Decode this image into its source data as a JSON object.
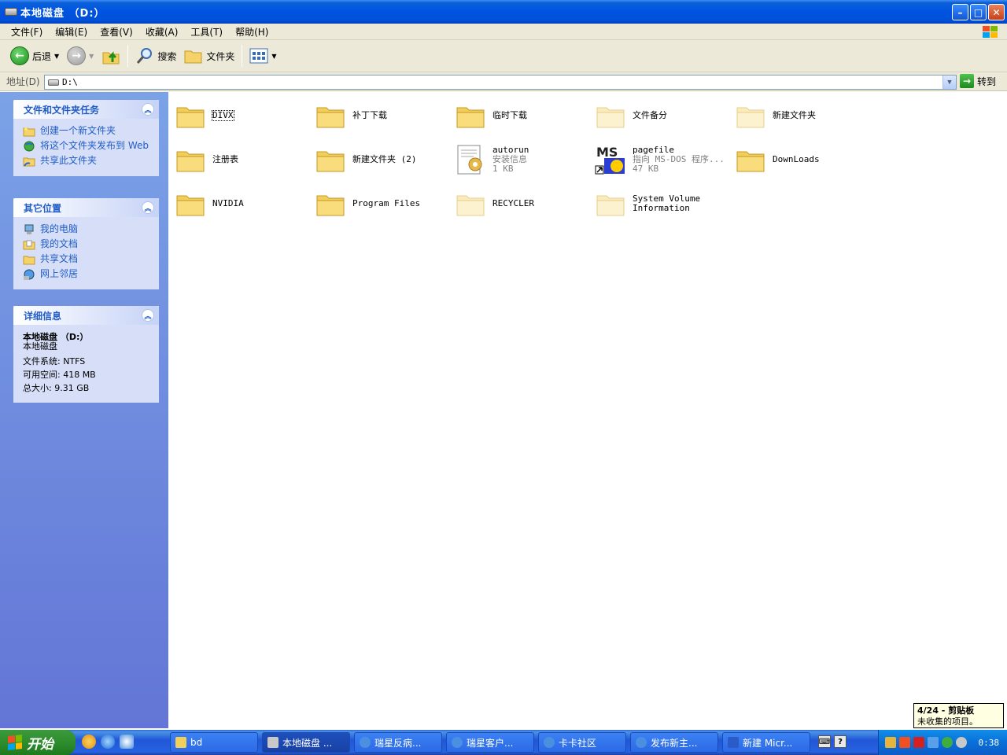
{
  "window": {
    "title": "本地磁盘 （D:）",
    "min": "–",
    "max": "□",
    "close": "✕"
  },
  "menu": [
    "文件(F)",
    "编辑(E)",
    "查看(V)",
    "收藏(A)",
    "工具(T)",
    "帮助(H)"
  ],
  "toolbar": {
    "back": "后退",
    "search": "搜索",
    "folders": "文件夹"
  },
  "address": {
    "label": "地址(D)",
    "value": "D:\\",
    "go": "转到"
  },
  "tasks_panel": {
    "title": "文件和文件夹任务",
    "items": [
      "创建一个新文件夹",
      "将这个文件夹发布到 Web",
      "共享此文件夹"
    ]
  },
  "places_panel": {
    "title": "其它位置",
    "items": [
      "我的电脑",
      "我的文档",
      "共享文档",
      "网上邻居"
    ]
  },
  "details_panel": {
    "title": "详细信息",
    "name": "本地磁盘 （D:）",
    "type": "本地磁盘",
    "fs": "文件系统: NTFS",
    "free": "可用空间: 418 MB",
    "total": "总大小: 9.31 GB"
  },
  "files": [
    {
      "name": "DIVX",
      "sub1": "",
      "sub2": "",
      "icon": "folder-icon"
    },
    {
      "name": "补丁下载",
      "sub1": "",
      "sub2": "",
      "icon": "folder-icon"
    },
    {
      "name": "临时下载",
      "sub1": "",
      "sub2": "",
      "icon": "folder-icon"
    },
    {
      "name": "文件备分",
      "sub1": "",
      "sub2": "",
      "icon": "folder-icon"
    },
    {
      "name": "新建文件夹",
      "sub1": "",
      "sub2": "",
      "icon": "folder-icon"
    },
    {
      "name": "注册表",
      "sub1": "",
      "sub2": "",
      "icon": "folder-icon"
    },
    {
      "name": "新建文件夹 (2)",
      "sub1": "",
      "sub2": "",
      "icon": "folder-icon"
    },
    {
      "name": "autorun",
      "sub1": "安装信息",
      "sub2": "1 KB",
      "icon": "setup-info-icon"
    },
    {
      "name": "pagefile",
      "sub1": "指向 MS-DOS 程序...",
      "sub2": "47 KB",
      "icon": "msdos-shortcut-icon"
    },
    {
      "name": "DownLoads",
      "sub1": "",
      "sub2": "",
      "icon": "folder-icon"
    },
    {
      "name": "NVIDIA",
      "sub1": "",
      "sub2": "",
      "icon": "folder-icon"
    },
    {
      "name": "Program Files",
      "sub1": "",
      "sub2": "",
      "icon": "folder-icon"
    },
    {
      "name": "RECYCLER",
      "sub1": "",
      "sub2": "",
      "icon": "folder-icon"
    },
    {
      "name": "System Volume Information",
      "sub1": "",
      "sub2": "",
      "icon": "folder-icon"
    }
  ],
  "clipboard": {
    "line1": "4/24 - 剪贴板",
    "line2": "未收集的项目。"
  },
  "taskbar": {
    "start": "开始",
    "buttons": [
      "bd",
      "本地磁盘 ...",
      "瑞星反病...",
      "瑞星客户...",
      "卡卡社区",
      "发布新主...",
      "新建 Micr..."
    ],
    "clock": "0:38"
  },
  "colors": {
    "titlebar": "#0053e1",
    "link": "#215dc6",
    "leftpane": "#6375d6",
    "folder": "#f6d26b"
  }
}
